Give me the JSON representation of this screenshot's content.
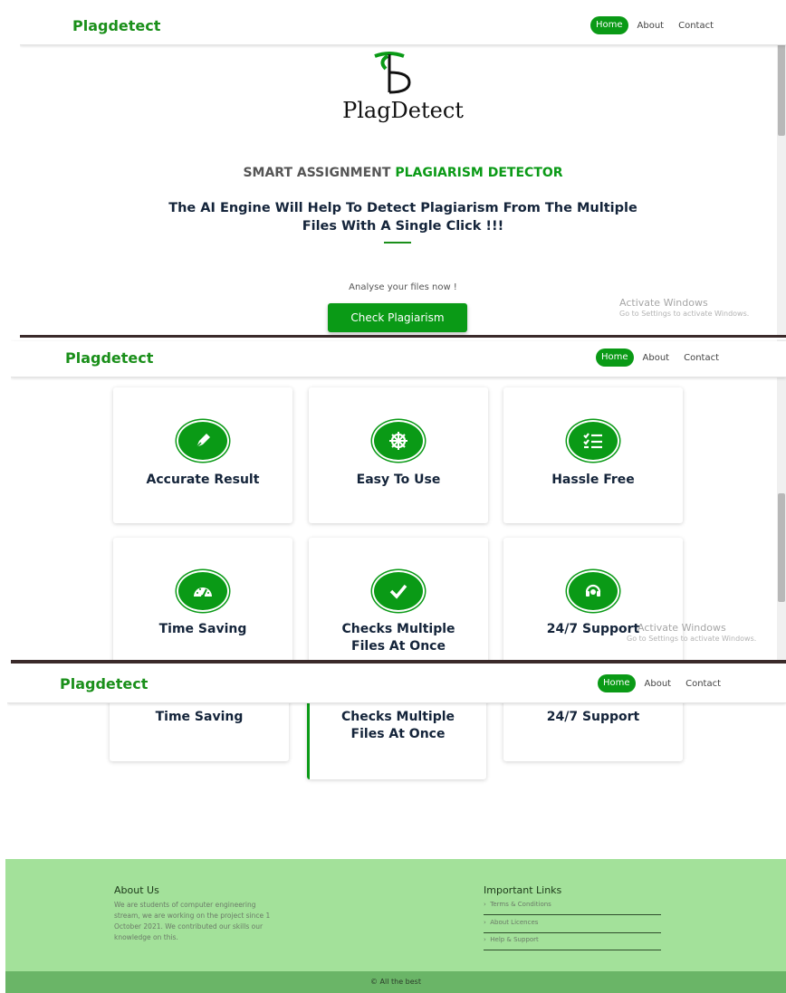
{
  "brand": "Plagdetect",
  "nav": {
    "home": "Home",
    "about": "About",
    "contact": "Contact"
  },
  "hero": {
    "logo_text": "PlagDetect",
    "tagline_prefix": "SMART ASSIGNMENT ",
    "tagline_highlight": "PLAGIARISM DETECTOR",
    "headline_line1": "The AI Engine Will Help To Detect Plagiarism From The Multiple",
    "headline_line2": "Files With A Single Click !!!",
    "analyse_text": "Analyse your files now !",
    "cta_label": "Check Plagiarism"
  },
  "watermark": {
    "title": "Activate Windows",
    "subtitle": "Go to Settings to activate Windows."
  },
  "features": [
    {
      "title": "Accurate Result",
      "icon": "pen-icon"
    },
    {
      "title": "Easy To Use",
      "icon": "ship-wheel-icon"
    },
    {
      "title": "Hassle Free",
      "icon": "checklist-icon"
    },
    {
      "title": "Time Saving",
      "icon": "speedometer-icon"
    },
    {
      "title": "Checks Multiple Files At Once",
      "icon": "checkmark-icon"
    },
    {
      "title": "24/7 Support",
      "icon": "headset-icon"
    }
  ],
  "features_split": {
    "multi_line1": "Checks Multiple",
    "multi_line2": "Files At Once"
  },
  "footer": {
    "about_title": "About Us",
    "about_line1": "We are students of computer engineering",
    "about_line2": "stream, we are working on the project since 1",
    "about_line3": "October 2021. We contributed our skills our",
    "about_line4": "knowledge on this.",
    "links_title": "Important Links",
    "links": [
      "Terms & Conditions",
      "About Licences",
      "Help & Support"
    ],
    "copyright": "© All the best"
  },
  "colors": {
    "primary_green": "#0a9a16",
    "footer_bg": "#a3e19a",
    "footer_bottom": "#6ab567",
    "text_dark": "#14243a"
  }
}
